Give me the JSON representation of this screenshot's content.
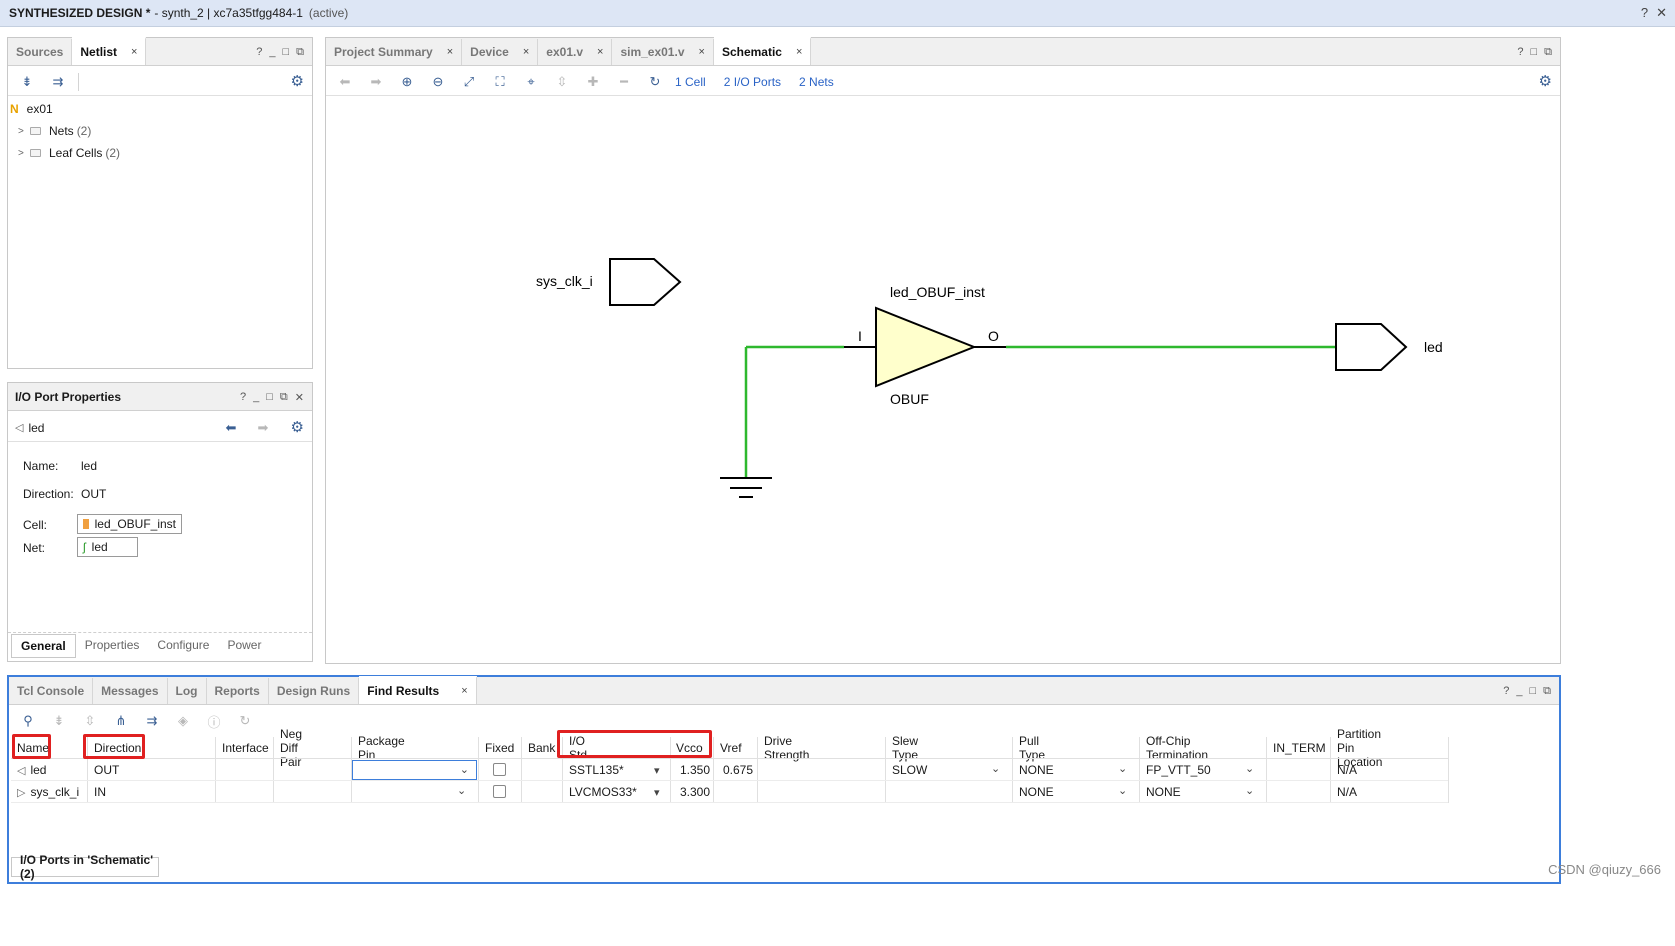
{
  "window": {
    "title_main": "SYNTHESIZED DESIGN *",
    "title_sub": "- synth_2 | xc7a35tfgg484-1",
    "title_state": "(active)",
    "controls": [
      "?",
      "✕"
    ]
  },
  "netlist_panel": {
    "tabs": [
      {
        "label": "Sources"
      },
      {
        "label": "Netlist",
        "close": "×"
      }
    ],
    "ctrl": [
      "?",
      "_",
      "□",
      "⧉"
    ],
    "root": {
      "badge": "N",
      "label": "ex01"
    },
    "items": [
      {
        "label": "Nets",
        "count": "(2)"
      },
      {
        "label": "Leaf Cells",
        "count": "(2)"
      }
    ]
  },
  "props_panel": {
    "title": "I/O Port Properties",
    "ctrl": [
      "?",
      "_",
      "□",
      "⧉",
      "✕"
    ],
    "object": "led",
    "name_label": "Name:",
    "name_value": "led",
    "direction_label": "Direction:",
    "direction_value": "OUT",
    "cell_label": "Cell:",
    "cell_value": "led_OBUF_inst",
    "net_label": "Net:",
    "net_value": "led",
    "bottom_tabs": [
      "General",
      "Properties",
      "Configure",
      "Power"
    ]
  },
  "editor": {
    "tabs": [
      {
        "label": "Project Summary",
        "close": "×"
      },
      {
        "label": "Device",
        "close": "×"
      },
      {
        "label": "ex01.v",
        "close": "×"
      },
      {
        "label": "sim_ex01.v",
        "close": "×"
      },
      {
        "label": "Schematic",
        "close": "×"
      }
    ],
    "ctrl": [
      "?",
      "□",
      "⧉"
    ],
    "links": [
      "1 Cell",
      "2 I/O Ports",
      "2 Nets"
    ]
  },
  "schematic": {
    "input_port": "sys_clk_i",
    "cell_instance": "led_OBUF_inst",
    "cell_type": "OBUF",
    "pin_in": "I",
    "pin_out": "O",
    "output_port": "led",
    "colors": {
      "wire": "#2eb82e",
      "buffer_fill": "#ffffcc",
      "outline": "#000000"
    }
  },
  "bottom_panel": {
    "tabs": [
      {
        "label": "Tcl Console"
      },
      {
        "label": "Messages"
      },
      {
        "label": "Log"
      },
      {
        "label": "Reports"
      },
      {
        "label": "Design Runs"
      },
      {
        "label": "Find Results",
        "close": "×"
      }
    ],
    "ctrl": [
      "?",
      "_",
      "□",
      "⧉"
    ],
    "columns": [
      "Name",
      "Direction",
      "Interface",
      "Neg Diff Pair",
      "Package Pin",
      "Fixed",
      "Bank",
      "I/O Std",
      "Vcco",
      "Vref",
      "Drive Strength",
      "Slew Type",
      "Pull Type",
      "Off-Chip Termination",
      "IN_TERM",
      "Partition Pin Location"
    ],
    "rows": [
      {
        "name": "led",
        "direction": "OUT",
        "iostd": "SSTL135*",
        "vcco": "1.350",
        "vref": "0.675",
        "slew": "SLOW",
        "pull": "NONE",
        "term": "FP_VTT_50",
        "partition": "N/A"
      },
      {
        "name": "sys_clk_i",
        "direction": "IN",
        "iostd": "LVCMOS33*",
        "vcco": "3.300",
        "vref": "",
        "slew": "",
        "pull": "NONE",
        "term": "NONE",
        "partition": "N/A"
      }
    ],
    "status": "I/O Ports in 'Schematic' (2)",
    "highlight_color": "#e02020"
  },
  "watermark": "CSDN @qiuzy_666"
}
